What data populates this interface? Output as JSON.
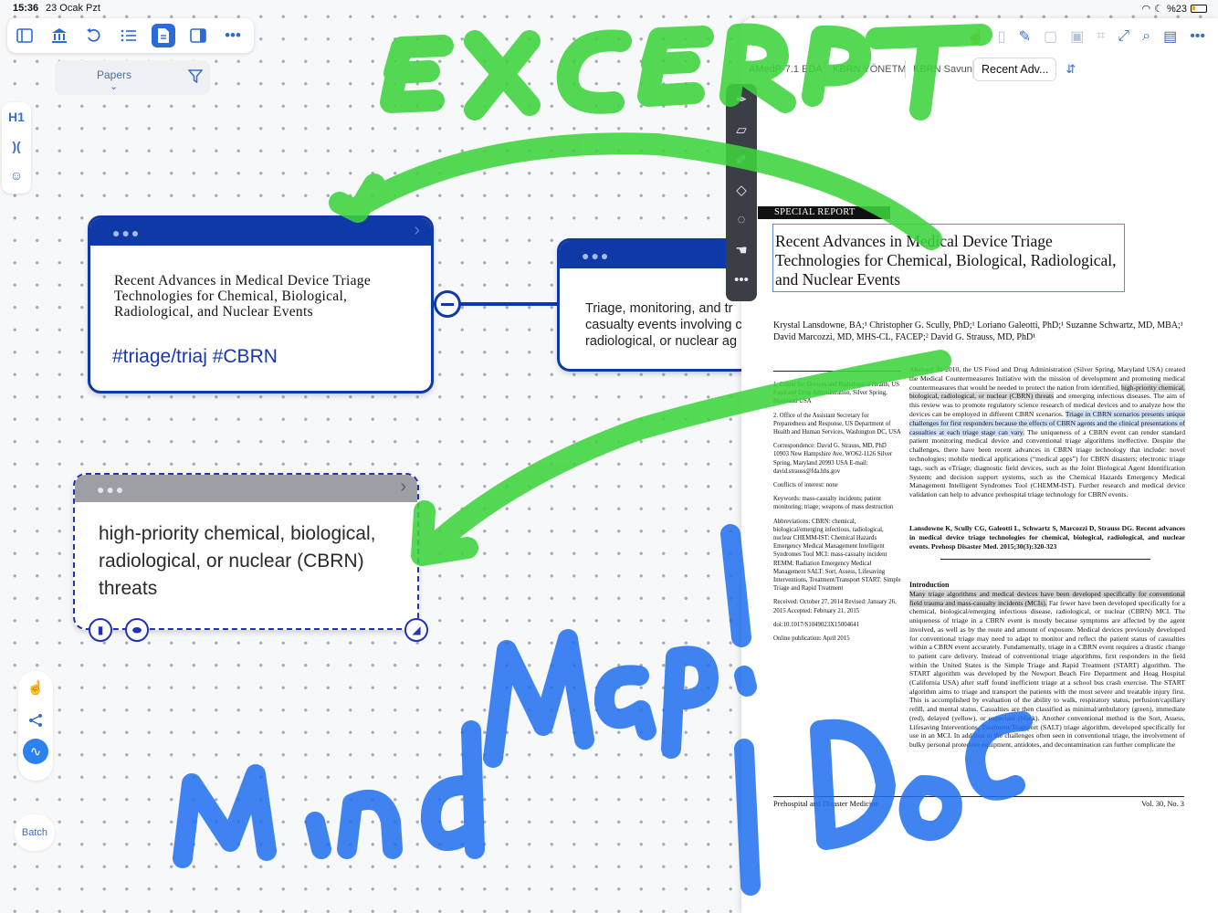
{
  "status_bar": {
    "time": "15:36",
    "date": "23 Ocak Pzt",
    "battery": "%23"
  },
  "left_toolbar": {
    "icons": [
      "sidebar-icon",
      "library-icon",
      "undo-icon",
      "outline-list-icon",
      "document-icon",
      "split-view-icon",
      "more-icon"
    ]
  },
  "papers_filter": {
    "label": "Papers",
    "chevron": "⌄"
  },
  "side_tools": {
    "heading": "H1",
    "bracket": ")(",
    "emoji": "☺"
  },
  "mind_map": {
    "card1": {
      "title": "Recent Advances in Medical Device Triage Technologies for Chemical, Biological, Radiological, and Nuclear Events",
      "tag": "#triage/triaj #CBRN"
    },
    "card2": {
      "text_lines": [
        "Triage, monitoring, and tr",
        "casualty events involving c",
        "radiological, or nuclear ag"
      ]
    },
    "card3": {
      "text": "high-priority chemical, biological, radiological, or nuclear (CBRN) threats"
    }
  },
  "mode_tools": {
    "batch_label": "Batch"
  },
  "pdf": {
    "tabs": [
      "AMedP-7.1 EDA V...",
      "KBRN YÖNETME...",
      "KBRN Savun...",
      "Recent Adv..."
    ],
    "section_label": "SPECIAL REPORT",
    "title": "Recent Advances in Medical Device Triage Technologies for Chemical, Biological, Radiological, and Nuclear Events",
    "authors": "Krystal Lansdowne, BA;¹ Christopher G. Scully, PhD;¹ Loriano Galeotti, PhD;¹ Suzanne Schwartz, MD, MBA;¹ David Marcozzi, MD, MHS-CL, FACEP;² David G. Strauss, MD, PhD¹",
    "abstract_pre": "Abstract: In 2010, the US Food and Drug Administration (Silver Spring, Maryland USA) created the Medical Countermeasures Initiative with the mission of development and promoting medical countermeasures that would be needed to protect the nation from identified, ",
    "abstract_hl2": "high-priority chemical, biological, radiological, or nuclear (CBRN) threats",
    "abstract_mid": " and emerging infectious diseases. The aim of this review was to promote regulatory science research of medical devices and to analyze how the devices can be employed in different CBRN scenarios. ",
    "abstract_hl": "Triage in CBRN scenarios presents unique challenges for first responders because the effects of CBRN agents and the clinical presentations of casualties at each triage stage can vary.",
    "abstract_post": " The uniqueness of a CBRN event can render standard patient monitoring medical device and conventional triage algorithms ineffective. Despite the challenges, there have been recent advances in CBRN triage technology that include: novel technologies; mobile medical applications (“medical apps”) for CBRN disasters; electronic triage tags, such as eTriage; diagnostic field devices, such as the Joint Biological Agent Identification System; and decision support systems, such as the Chemical Hazards Emergency Medical Management Intelligent Syndromes Tool (CHEMM-IST). Further research and medical device validation can help to advance prehospital triage technology for CBRN events.",
    "citation": "Lansdowne K, Scully CG, Galeotti L, Schwartz S, Marcozzi D, Strauss DG. Recent advances in medical device triage technologies for chemical, biological, radiological, and nuclear events. Prehosp Disaster Med. 2015;30(3):320-323",
    "left_col": [
      "1. Center for Devices and Radiological Health, US Food and Drug Administration, Silver Spring, Maryland USA",
      "2. Office of the Assistant Secretary for Preparedness and Response, US Department of Health and Human Services, Washington DC, USA",
      "Correspondence: David G. Strauss, MD, PhD 10903 New Hampshire Ave, WO62-1126 Silver Spring, Maryland 20993 USA E-mail: david.strauss@fda.hhs.gov",
      "Conflicts of interest: none",
      "Keywords: mass-casualty incidents; patient monitoring; triage; weapons of mass destruction",
      "Abbreviations: CBRN: chemical, biological/emerging infectious, radiological, nuclear CHEMM-IST: Chemical Hazards Emergency Medical Management Intelligent Syndromes Tool MCI: mass-casualty incident REMM: Radiation Emergency Medical Management SALT: Sort, Assess, Lifesaving Interventions, Treatment/Transport START: Simple Triage and Rapid Treatment",
      "Received: October 27, 2014 Revised: January 26, 2015 Accepted: February 21, 2015",
      "doi:10.1017/S1049023X15004641",
      "Online publication: April 2015"
    ],
    "intro_heading": "Introduction",
    "intro_hl": "Many triage algorithms and medical devices have been developed specifically for conventional field trauma and mass-casualty incidents (MCIs).",
    "intro_rest": " Far fewer have been developed specifically for a chemical, biological/emerging infectious disease, radiological, or nuclear (CBRN) MCI. The uniqueness of triage in a CBRN event is mostly because symptoms are affected by the agent involved, as well as by the route and amount of exposure. Medical devices previously developed for conventional triage may need to adapt to monitor and reflect the patient status of casualties within a CBRN event accurately. Fundamentally, triage in a CBRN event requires a drastic change to patient care delivery. Instead of conventional triage algorithms, first responders in the field within the United States is the Simple Triage and Rapid Treatment (START) algorithm. The START algorithm was developed by the Newport Beach Fire Department and Hoag Hospital (California USA) after staff found inefficient triage at a school bus crash exercise. The START algorithm aims to triage and transport the patients with the most severe and treatable injury first. This is accomplished by evaluation of the ability to walk, respiratory status, perfusion/capillary refill, and mental status. Casualties are then classified as minimal/ambulatory (green), immediate (red), delayed (yellow), or expectant (black). Another conventional method is the Sort, Assess, Lifesaving Interventions, Treatment/Transport (SALT) triage algorithm, developed specifically for use in an MCI. In addition to the challenges often seen in conventional triage, the involvement of bulky personal protective equipment, antidotes, and decontamination can further complicate the",
    "footer_left": "Prehospital and Disaster Medicine",
    "footer_right": "Vol. 30, No. 3"
  },
  "pen_toolbar": {
    "icons": [
      "pen-icon",
      "highlighter-icon",
      "pencil-icon",
      "eraser-icon",
      "lasso-icon",
      "hand-icon",
      "more-icon"
    ]
  },
  "ink": {
    "green_word": "EXCERPT",
    "green_color": "#3ed43e",
    "blue_words": [
      "Mind",
      "Map",
      "Doc"
    ],
    "blue_color": "#1f6ff0"
  }
}
